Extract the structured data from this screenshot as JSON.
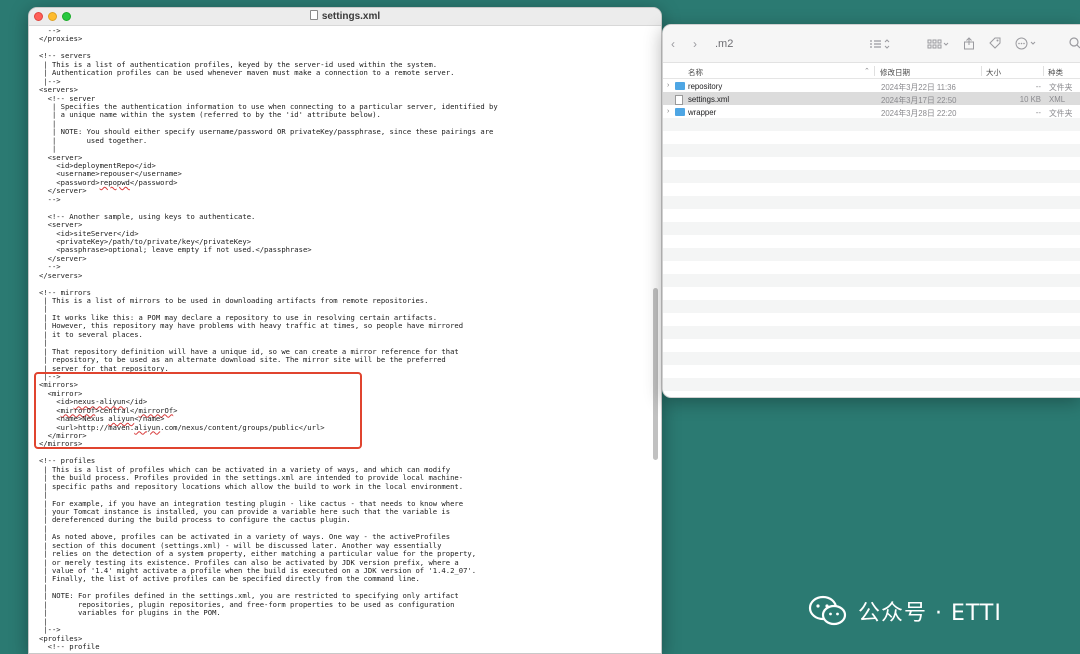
{
  "editor": {
    "title": "settings.xml",
    "lines": [
      "  -->",
      "</proxies>",
      "",
      "<!-- servers",
      " | This is a list of authentication profiles, keyed by the server-id used within the system.",
      " | Authentication profiles can be used whenever maven must make a connection to a remote server.",
      " |-->",
      "<servers>",
      "  <!-- server",
      "   | Specifies the authentication information to use when connecting to a particular server, identified by",
      "   | a unique name within the system (referred to by the 'id' attribute below).",
      "   |",
      "   | NOTE: You should either specify username/password OR privateKey/passphrase, since these pairings are",
      "   |       used together.",
      "   |",
      "  <server>",
      "    <id>deploymentRepo</id>",
      "    <username>repouser</username>",
      "    <password>repopwd</password>",
      "  </server>",
      "  -->",
      "",
      "  <!-- Another sample, using keys to authenticate.",
      "  <server>",
      "    <id>siteServer</id>",
      "    <privateKey>/path/to/private/key</privateKey>",
      "    <passphrase>optional; leave empty if not used.</passphrase>",
      "  </server>",
      "  -->",
      "</servers>",
      "",
      "<!-- mirrors",
      " | This is a list of mirrors to be used in downloading artifacts from remote repositories.",
      " |",
      " | It works like this: a POM may declare a repository to use in resolving certain artifacts.",
      " | However, this repository may have problems with heavy traffic at times, so people have mirrored",
      " | it to several places.",
      " |",
      " | That repository definition will have a unique id, so we can create a mirror reference for that",
      " | repository, to be used as an alternate download site. The mirror site will be the preferred",
      " | server for that repository.",
      " |-->",
      "<mirrors>",
      "  <mirror>",
      "    <id>nexus-aliyun</id>",
      "    <mirrorOf>central</mirrorOf>",
      "    <name>Nexus aliyun</name>",
      "    <url>http://maven.aliyun.com/nexus/content/groups/public</url>",
      "  </mirror>",
      "</mirrors>",
      "",
      "<!-- profiles",
      " | This is a list of profiles which can be activated in a variety of ways, and which can modify",
      " | the build process. Profiles provided in the settings.xml are intended to provide local machine-",
      " | specific paths and repository locations which allow the build to work in the local environment.",
      " |",
      " | For example, if you have an integration testing plugin - like cactus - that needs to know where",
      " | your Tomcat instance is installed, you can provide a variable here such that the variable is",
      " | dereferenced during the build process to configure the cactus plugin.",
      " |",
      " | As noted above, profiles can be activated in a variety of ways. One way - the activeProfiles",
      " | section of this document (settings.xml) - will be discussed later. Another way essentially",
      " | relies on the detection of a system property, either matching a particular value for the property,",
      " | or merely testing its existence. Profiles can also be activated by JDK version prefix, where a",
      " | value of '1.4' might activate a profile when the build is executed on a JDK version of '1.4.2_07'.",
      " | Finally, the list of active profiles can be specified directly from the command line.",
      " |",
      " | NOTE: For profiles defined in the settings.xml, you are restricted to specifying only artifact",
      " |       repositories, plugin repositories, and free-form properties to be used as configuration",
      " |       variables for plugins in the POM.",
      " |",
      " |-->",
      "<profiles>",
      "  <!-- profile"
    ]
  },
  "finder": {
    "folder_title": ".m2",
    "columns": {
      "name": "名称",
      "date": "修改日期",
      "size": "大小",
      "kind": "种类"
    },
    "rows": [
      {
        "name": "repository",
        "date": "2024年3月22日 11:36",
        "size": "--",
        "kind": "文件夹",
        "type": "folder"
      },
      {
        "name": "settings.xml",
        "date": "2024年3月17日 22:50",
        "size": "10 KB",
        "kind": "XML",
        "type": "file"
      },
      {
        "name": "wrapper",
        "date": "2024年3月28日 22:20",
        "size": "--",
        "kind": "文件夹",
        "type": "folder"
      }
    ]
  },
  "watermark": {
    "text": "公众号 · ETTI"
  },
  "colors": {
    "desktop": "#2b7a72",
    "highlight": "#e0442f",
    "folder": "#4ea6e4"
  }
}
